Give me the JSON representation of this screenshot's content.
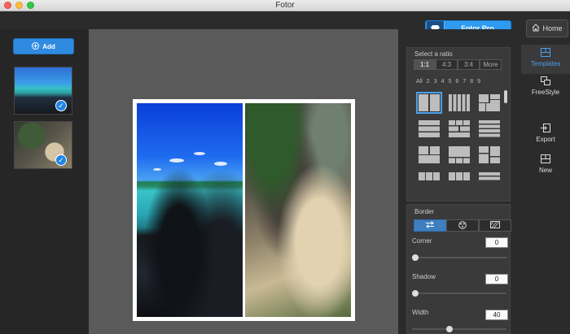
{
  "window": {
    "title": "Fotor"
  },
  "header": {
    "pro_label": "Fotor Pro",
    "home_label": "Home"
  },
  "left": {
    "add_label": "Add",
    "photos": [
      {
        "checked": true
      },
      {
        "checked": true
      }
    ]
  },
  "templates": {
    "section_label": "Select a ratio",
    "ratios": [
      "1:1",
      "4:3",
      "3:4",
      "More"
    ],
    "active_ratio": "1:1",
    "counts": [
      "All",
      "2",
      "3",
      "4",
      "5",
      "6",
      "7",
      "8",
      "9"
    ]
  },
  "border": {
    "section_label": "Border",
    "corner": {
      "label": "Corner",
      "value": "0"
    },
    "shadow": {
      "label": "Shadow",
      "value": "0"
    },
    "width": {
      "label": "Width",
      "value": "40"
    }
  },
  "tools": {
    "templates": "Templates",
    "freestyle": "FreeStyle",
    "export": "Export",
    "new": "New"
  },
  "colors": {
    "accent": "#2e9bf0",
    "canvas": "#5a5a5a"
  }
}
